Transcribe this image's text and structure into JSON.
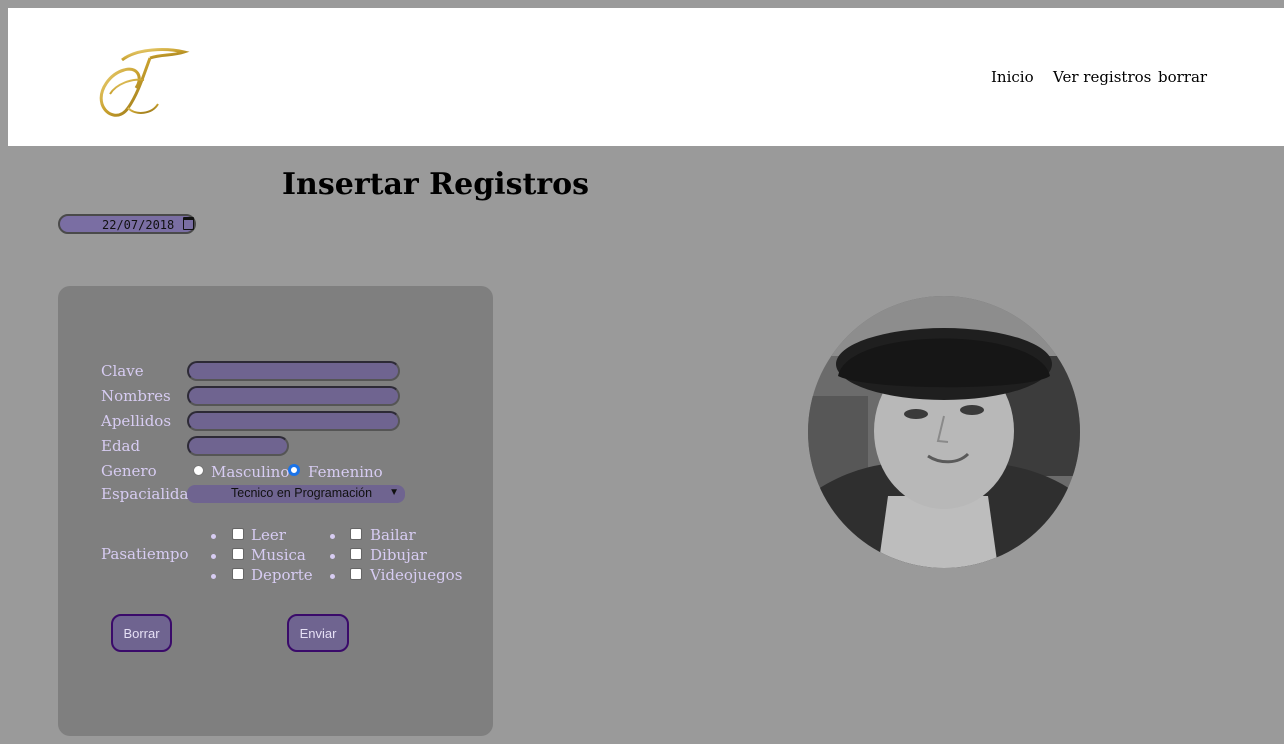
{
  "header": {
    "nav": [
      "Inicio",
      "Ver registros",
      "borrar"
    ]
  },
  "title": "Insertar Registros",
  "date": {
    "value": "22/07/2018"
  },
  "form": {
    "labels": {
      "clave": "Clave",
      "nombres": "Nombres",
      "apellidos": "Apellidos",
      "edad": "Edad",
      "genero": "Genero",
      "especialidad": "Espacialidad",
      "pasatiempo": "Pasatiempo"
    },
    "genero_options": [
      "Masculino",
      "Femenino"
    ],
    "genero_selected": "Femenino",
    "especialidad_selected": "Tecnico en Programación",
    "pasatiempos_col1": [
      "Leer",
      "Musica",
      "Deporte"
    ],
    "pasatiempos_col2": [
      "Bailar",
      "Dibujar",
      "Videojuegos"
    ],
    "buttons": {
      "reset": "Borrar",
      "submit": "Enviar"
    }
  },
  "colors": {
    "background": "#9a9a9a",
    "card": "#7f7f7f",
    "field": "#6f6490",
    "label": "#d7ccf2",
    "button_border": "#3a0a6a"
  }
}
